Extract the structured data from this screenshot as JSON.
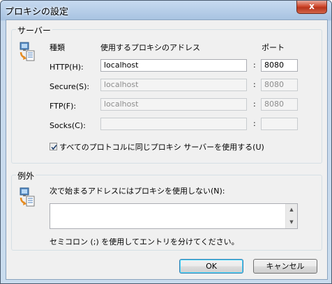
{
  "window": {
    "title": "プロキシの設定",
    "close_label": "x"
  },
  "servers": {
    "group_label": "サーバー",
    "col_type": "種類",
    "col_address": "使用するプロキシのアドレス",
    "col_port": "ポート",
    "rows": [
      {
        "label": "HTTP(H):",
        "address": "localhost",
        "port": "8080",
        "enabled": true
      },
      {
        "label": "Secure(S):",
        "address": "localhost",
        "port": "8080",
        "enabled": false
      },
      {
        "label": "FTP(F):",
        "address": "localhost",
        "port": "8080",
        "enabled": false
      },
      {
        "label": "Socks(C):",
        "address": "",
        "port": "",
        "enabled": false
      }
    ],
    "colon": ":",
    "same_proxy_checkbox": {
      "label": "すべてのプロトコルに同じプロキシ サーバーを使用する(U)",
      "checked": true
    }
  },
  "exceptions": {
    "group_label": "例外",
    "prompt": "次で始まるアドレスにはプロキシを使用しない(N):",
    "value": "",
    "hint": "セミコロン (;) を使用してエントリを分けてください。"
  },
  "buttons": {
    "ok": "OK",
    "cancel": "キャンセル"
  },
  "icons": {
    "server": "computer-network-icon",
    "exceptions": "computer-network-icon"
  }
}
